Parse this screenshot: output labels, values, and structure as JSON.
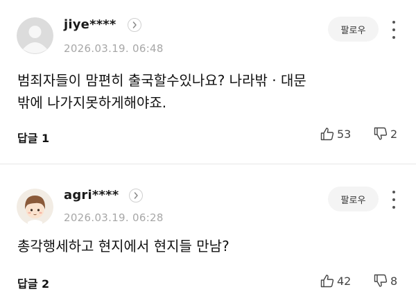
{
  "comments": [
    {
      "username": "jiye****",
      "date": "2026.03.19. 06:48",
      "follow_label": "팔로우",
      "text_line1": "범죄자들이 맘편히 출국할수있나요? 나라밖 · 대문",
      "text_line2": "밖에 나가지못하게해야죠.",
      "reply_label": "답글 1",
      "likes": "53",
      "dislikes": "2",
      "avatar": "default-user-icon"
    },
    {
      "username": "agri****",
      "date": "2026.03.19. 06:28",
      "follow_label": "팔로우",
      "text_line1": "총각행세하고 현지에서 현지들 만남?",
      "text_line2": "",
      "reply_label": "답글 2",
      "likes": "42",
      "dislikes": "8",
      "avatar": "cartoon-boy-avatar"
    }
  ],
  "icons": {
    "like": "thumbs-up-icon",
    "dislike": "thumbs-down-icon",
    "more": "more-vertical-icon",
    "chevron": "chevron-right-icon"
  }
}
